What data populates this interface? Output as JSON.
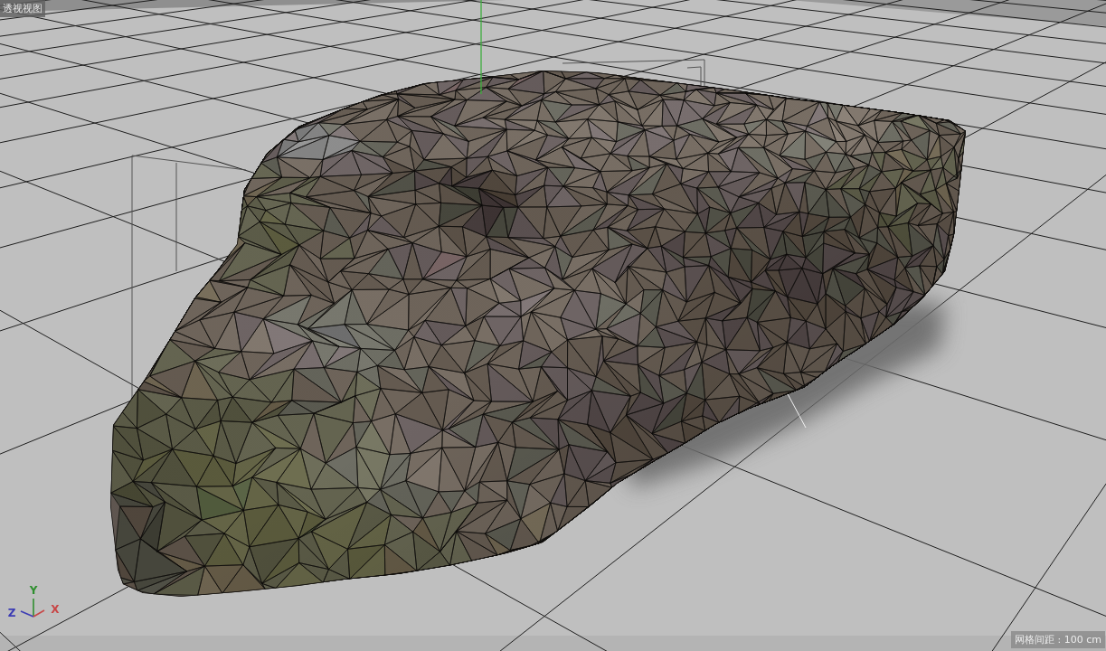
{
  "viewport": {
    "title": "透视视图"
  },
  "axis_gizmo": {
    "axes": [
      {
        "kind": "y",
        "label": "Y",
        "color": "#2f8f2f"
      },
      {
        "kind": "z",
        "label": "Z",
        "color": "#3c3cb4"
      },
      {
        "kind": "x",
        "label": "X",
        "color": "#c84646"
      }
    ]
  },
  "grid_info": {
    "text": "网格间距 : 100 cm"
  }
}
